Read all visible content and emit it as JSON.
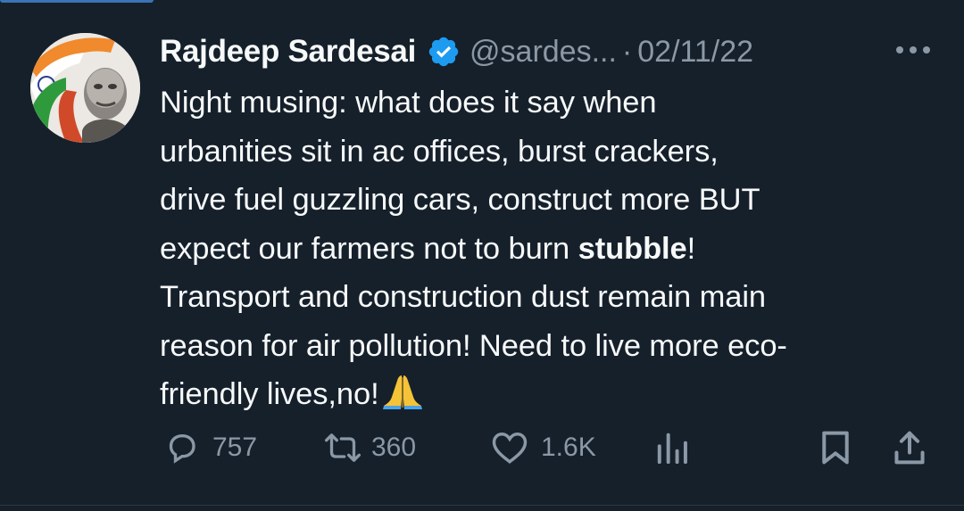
{
  "tweet": {
    "author": {
      "display_name": "Rajdeep Sardesai",
      "handle": "@sardes...",
      "verified": true
    },
    "separator": "·",
    "date": "02/11/22",
    "text_lines": [
      {
        "pre": "Night musing: what does it say when"
      },
      {
        "pre": "urbanities sit in ac offices, burst crackers,"
      },
      {
        "pre": "drive fuel guzzling cars, construct more BUT"
      },
      {
        "pre": "expect our farmers not to burn ",
        "bold": "stubble",
        "post": "!"
      },
      {
        "pre": "Transport and construction dust remain main"
      },
      {
        "pre": "reason for air pollution! Need to live more eco-"
      },
      {
        "pre": "friendly lives,no!",
        "emoji": "folded-hands"
      }
    ],
    "stats": {
      "replies": "757",
      "retweets": "360",
      "likes": "1.6K"
    }
  },
  "colors": {
    "background": "#15202b",
    "text": "#f7f9f9",
    "muted": "#8b98a5",
    "verified": "#1d9bf0"
  },
  "icons": [
    "verified-badge-icon",
    "more-options-icon",
    "reply-icon",
    "retweet-icon",
    "like-icon",
    "views-icon",
    "bookmark-icon",
    "share-icon",
    "folded-hands-emoji"
  ]
}
